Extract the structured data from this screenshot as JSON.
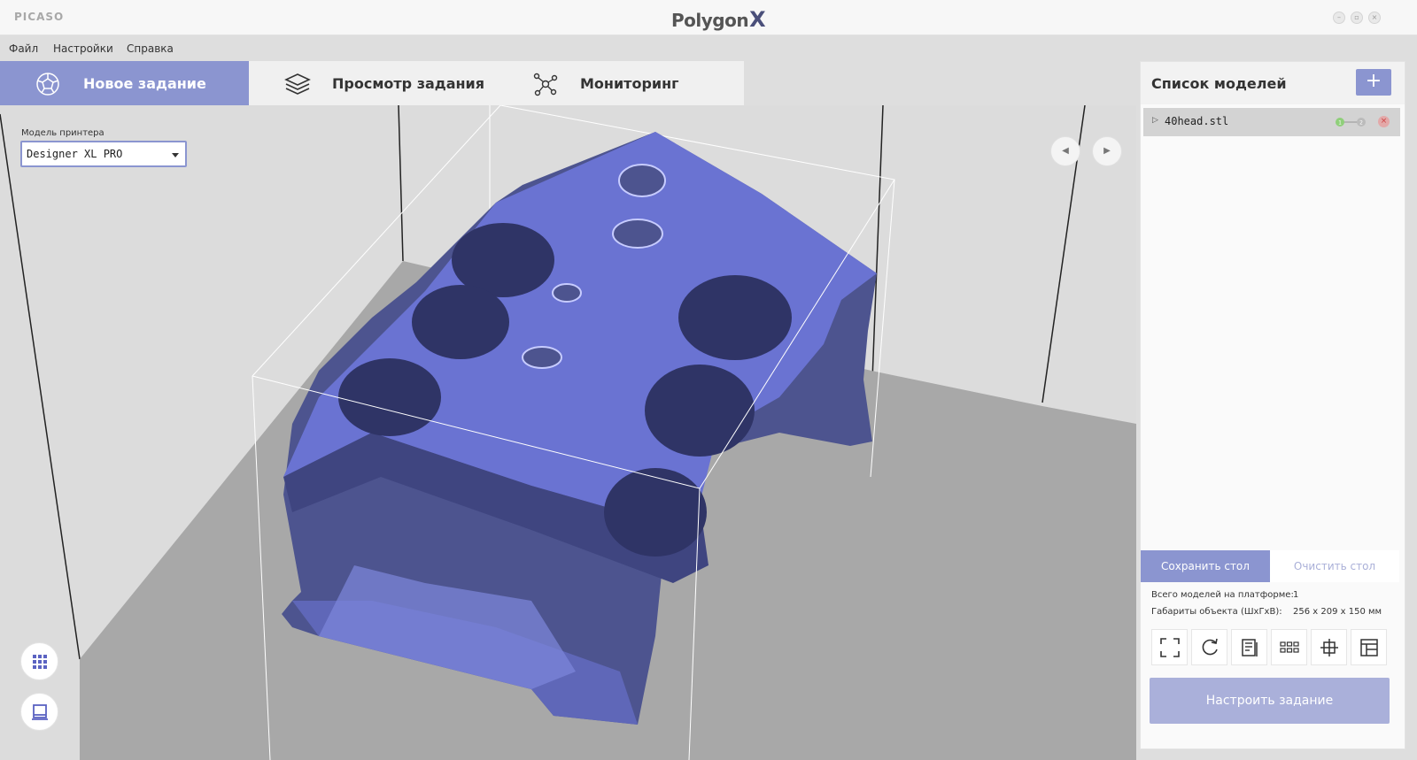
{
  "titlebar": {
    "brand": "PICASO",
    "app_title": "Polygon",
    "app_title_x": "X"
  },
  "menu": [
    "Файл",
    "Настройки",
    "Справка"
  ],
  "tabs": [
    {
      "label": "Новое задание",
      "icon": "polyhedron-icon",
      "active": true
    },
    {
      "label": "Просмотр задания",
      "icon": "layers-icon",
      "active": false
    },
    {
      "label": "Мониторинг",
      "icon": "network-icon",
      "active": false
    }
  ],
  "printer": {
    "label": "Модель принтера",
    "value": "Designer XL PRO"
  },
  "models_panel": {
    "title": "Список моделей",
    "add_label": "+",
    "models": [
      {
        "name": "40head.stl",
        "extruders": [
          "1",
          "2"
        ]
      }
    ]
  },
  "actions": {
    "save": "Сохранить стол",
    "clear": "Очистить стол",
    "configure": "Настроить задание"
  },
  "stats": {
    "total_label": "Всего моделей на платформе:",
    "total_value": "1",
    "dims_label": "Габариты объекта (ШхГхВ):",
    "dims_value": "256 x 209 x 150 мм"
  },
  "tools": [
    "fit-icon",
    "rotate-icon",
    "slice-preview-icon",
    "arrange-icon",
    "center-icon",
    "layout-icon"
  ],
  "colors": {
    "accent": "#8b95d0",
    "model": "#5b63c2",
    "platform": "#a5a5a5"
  }
}
